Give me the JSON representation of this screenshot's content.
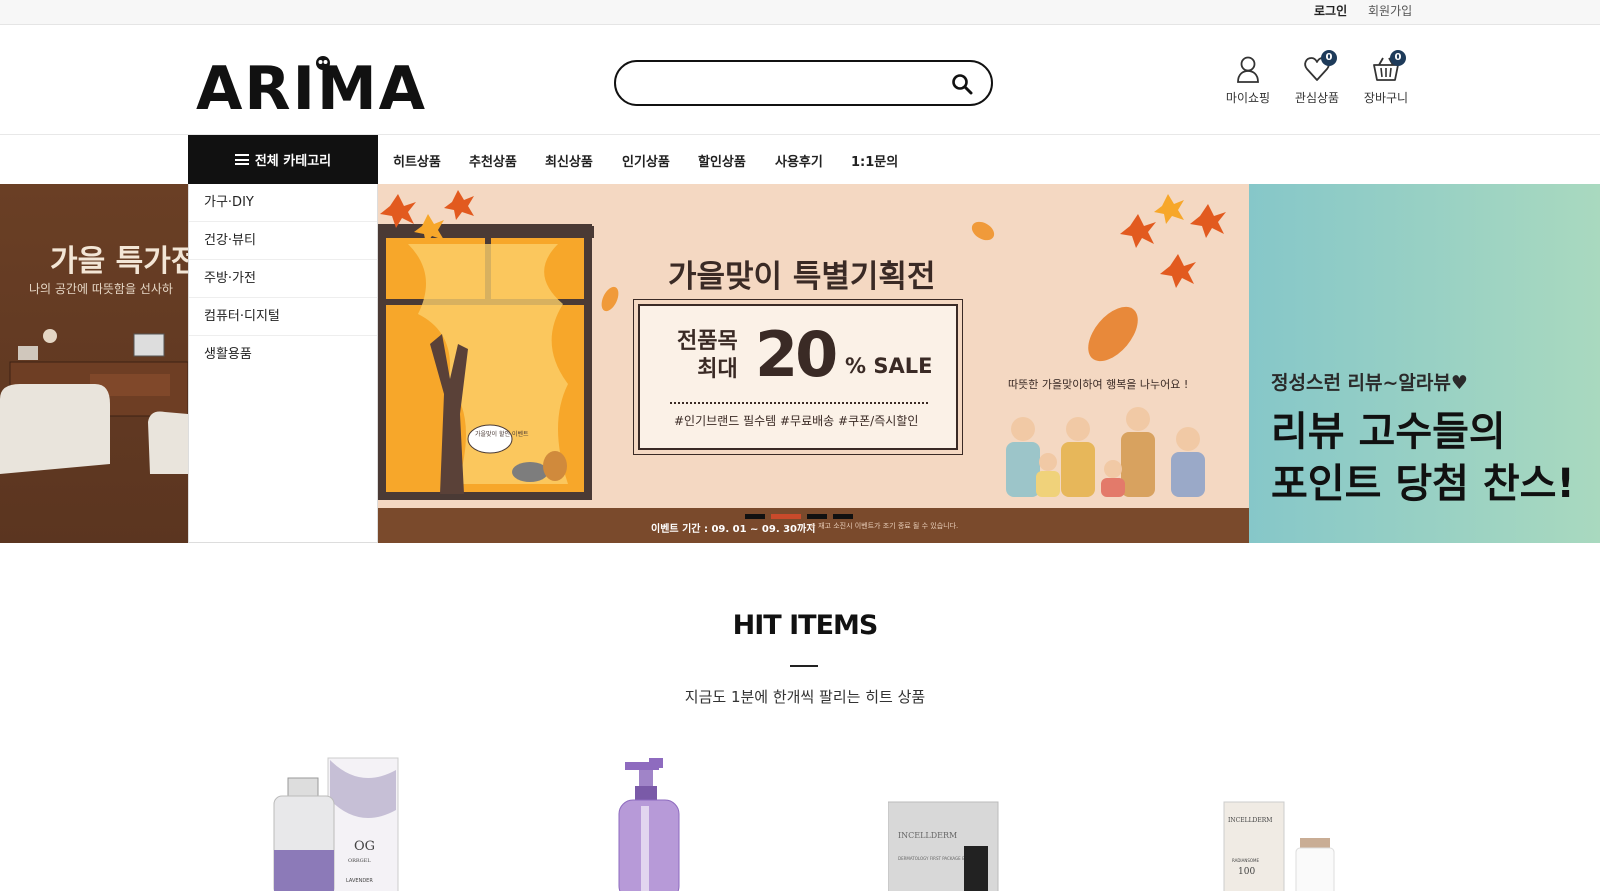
{
  "topbar": {
    "login": "로그인",
    "join": "회원가입"
  },
  "header": {
    "logo": "ARIMA",
    "search_placeholder": "",
    "icons": [
      {
        "label": "마이쇼핑",
        "icon": "user-icon"
      },
      {
        "label": "관심상품",
        "icon": "heart-icon",
        "count": "0"
      },
      {
        "label": "장바구니",
        "icon": "cart-icon",
        "count": "0"
      }
    ]
  },
  "nav": {
    "all_category": "전체 카테고리",
    "items": [
      "히트상품",
      "추천상품",
      "최신상품",
      "인기상품",
      "할인상품",
      "사용후기",
      "1:1문의"
    ]
  },
  "categories": [
    "가구·DIY",
    "건강·뷰티",
    "주방·가전",
    "컴퓨터·디지털",
    "생활용품"
  ],
  "banners": {
    "left": {
      "title": "가을 특가전",
      "subtitle": "나의 공간에 따뜻함을 선사하"
    },
    "main": {
      "title": "가을맞이 특별기획전",
      "line1": "전품목",
      "line2": "최대",
      "percent": "20",
      "sale": "% SALE",
      "tags": "#인기브랜드 필수템  #무료배송  #쿠폰/즉시할인",
      "window_note": "가을맞이 할인 이벤트",
      "warm_text": "따뜻한 가을맞이하여 행복을 나누어요 !",
      "period": "이벤트 기간 : 09. 01 ~ 09. 30까지",
      "note": "※ 재고 소진시 이벤트가 조기 종료 될 수 있습니다."
    },
    "right": {
      "line1": "정성스런 리뷰~알라뷰♥",
      "line2": "리뷰 고수들의",
      "line3": "포인트 당첨 찬스!"
    }
  },
  "hit": {
    "title": "HIT ITEMS",
    "subtitle": "지금도 1분에 한개씩 팔리는 히트 상품",
    "products": [
      {
        "brand": "OG",
        "brand_sub": "ORRGEL",
        "variant": "LAVENDER"
      },
      {
        "brand": "",
        "brand_sub": "",
        "variant": ""
      },
      {
        "brand": "INCELLDERM",
        "brand_sub": "DERMATOLOGY FIRST PACKAGE EX",
        "variant": ""
      },
      {
        "brand": "INCELLDERM",
        "brand_sub": "RADIANSOME",
        "variant": "100"
      }
    ]
  },
  "colors": {
    "badge": "#1e3b5a",
    "banner_bg": "#f4d8c2",
    "banner_brown": "#7a4a2c",
    "review_bg": "#86c7c9"
  }
}
